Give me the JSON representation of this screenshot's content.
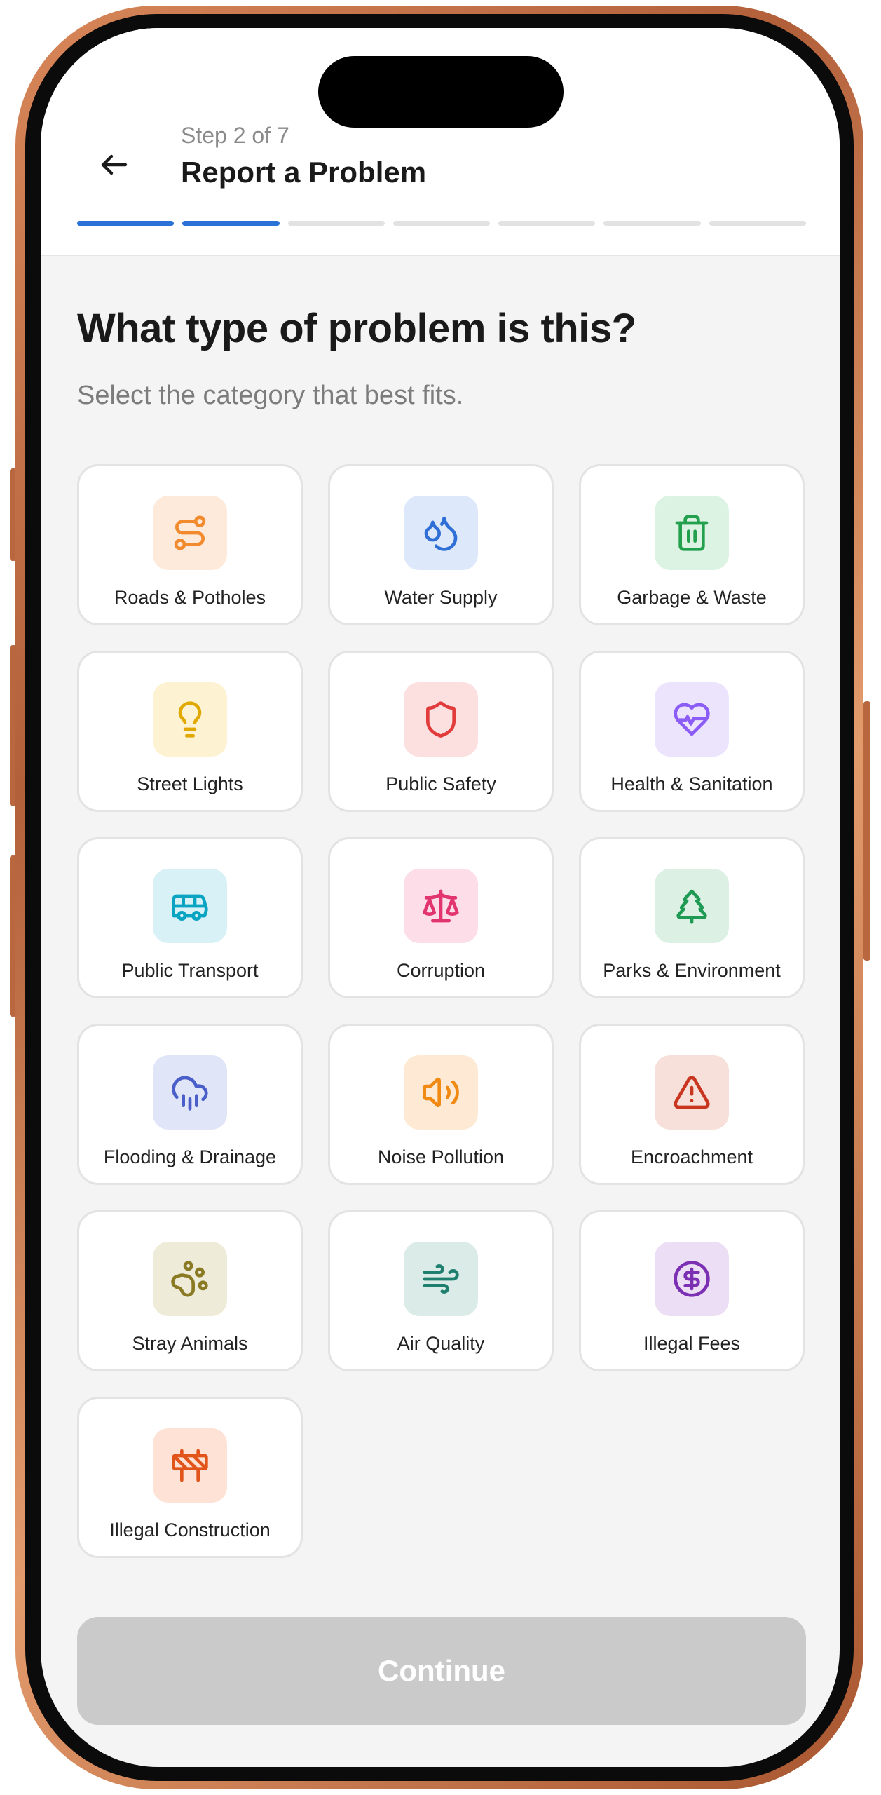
{
  "header": {
    "step_label": "Step 2 of 7",
    "title": "Report a Problem",
    "total_steps": 7,
    "current_step": 2
  },
  "question": {
    "title": "What type of problem is this?",
    "subtitle": "Select the category that best fits."
  },
  "categories": [
    {
      "label": "Roads & Potholes",
      "icon": "route-icon",
      "color": "#f28a2e",
      "bg": "#fdeadb"
    },
    {
      "label": "Water Supply",
      "icon": "droplets-icon",
      "color": "#2f6fd6",
      "bg": "#dde9fb"
    },
    {
      "label": "Garbage & Waste",
      "icon": "trash-icon",
      "color": "#22a04d",
      "bg": "#dcf3e3"
    },
    {
      "label": "Street Lights",
      "icon": "lightbulb-icon",
      "color": "#e0a800",
      "bg": "#fdf3d2"
    },
    {
      "label": "Public Safety",
      "icon": "shield-icon",
      "color": "#e23b3b",
      "bg": "#fcdfdf"
    },
    {
      "label": "Health & Sanitation",
      "icon": "heart-pulse-icon",
      "color": "#8b5cf6",
      "bg": "#ece4fd"
    },
    {
      "label": "Public Transport",
      "icon": "bus-icon",
      "color": "#0aa4c3",
      "bg": "#d7f1f7"
    },
    {
      "label": "Corruption",
      "icon": "scale-icon",
      "color": "#e2346f",
      "bg": "#fcdde8"
    },
    {
      "label": "Parks & Environment",
      "icon": "tree-icon",
      "color": "#1f9a55",
      "bg": "#dcf0e3"
    },
    {
      "label": "Flooding & Drainage",
      "icon": "cloud-rain-icon",
      "color": "#4a5fc9",
      "bg": "#e1e5f8"
    },
    {
      "label": "Noise Pollution",
      "icon": "speaker-icon",
      "color": "#f18a12",
      "bg": "#fde9d4"
    },
    {
      "label": "Encroachment",
      "icon": "warning-triangle-icon",
      "color": "#c9361f",
      "bg": "#f7e0da"
    },
    {
      "label": "Stray Animals",
      "icon": "paw-icon",
      "color": "#8a7a24",
      "bg": "#eeebd9"
    },
    {
      "label": "Air Quality",
      "icon": "wind-icon",
      "color": "#1f7f6e",
      "bg": "#dbece8"
    },
    {
      "label": "Illegal Fees",
      "icon": "dollar-icon",
      "color": "#7b2fb3",
      "bg": "#ecdff5"
    },
    {
      "label": "Illegal Construction",
      "icon": "barrier-icon",
      "color": "#e1541a",
      "bg": "#fde2d5"
    }
  ],
  "continue_label": "Continue",
  "colors": {
    "accent": "#2b72d7",
    "disabled_button": "#cacaca"
  }
}
